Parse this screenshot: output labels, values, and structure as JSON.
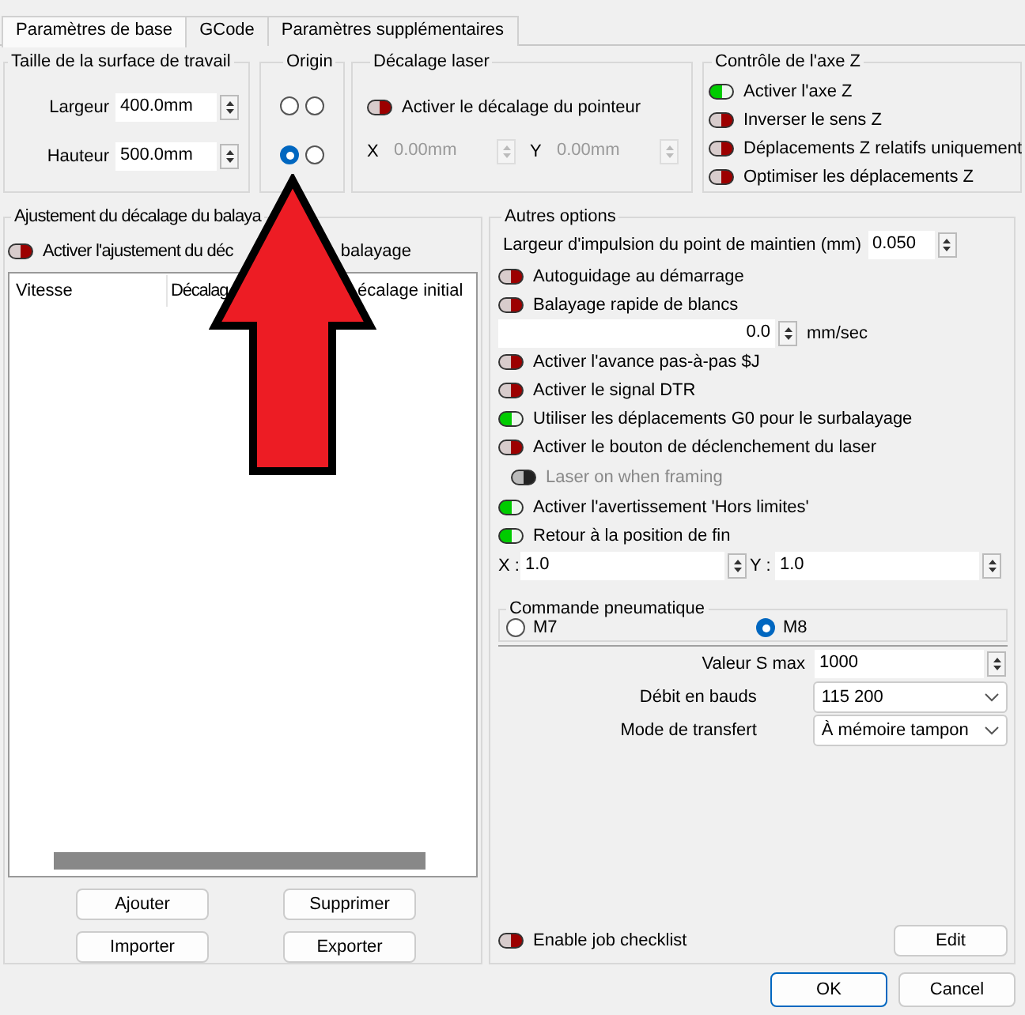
{
  "tabs": [
    {
      "label": "Paramètres de base",
      "selected": true
    },
    {
      "label": "GCode",
      "selected": false
    },
    {
      "label": "Paramètres supplémentaires",
      "selected": false
    }
  ],
  "work_area": {
    "title": "Taille de la surface de travail",
    "fields": [
      {
        "label": "Largeur",
        "value": "400.0mm"
      },
      {
        "label": "Hauteur",
        "value": "500.0mm"
      }
    ]
  },
  "origin": {
    "title": "Origin",
    "options": [
      {
        "selected": false
      },
      {
        "selected": false
      },
      {
        "selected": true
      },
      {
        "selected": false
      }
    ]
  },
  "laser_offset": {
    "title": "Décalage laser",
    "toggle": {
      "label": "Activer le décalage du pointeur",
      "on": false
    },
    "fields": [
      {
        "label": "X",
        "value": "0.00mm",
        "disabled": true
      },
      {
        "label": "Y",
        "value": "0.00mm",
        "disabled": true
      }
    ]
  },
  "z_axis": {
    "title": "Contrôle de l'axe Z",
    "options": [
      {
        "label": "Activer l'axe Z",
        "on": true
      },
      {
        "label": "Inverser le sens Z",
        "on": false
      },
      {
        "label": "Déplacements Z relatifs uniquement",
        "on": false
      },
      {
        "label": "Optimiser les déplacements Z",
        "on": false
      }
    ]
  },
  "scan_offset": {
    "title": "Ajustement du décalage du balaya",
    "toggle": {
      "label": "Activer l'ajustement du déc",
      "label_tail": "balayage",
      "on": false
    },
    "columns": [
      "Vitesse",
      "Décalag",
      "écalage initial"
    ],
    "buttons": [
      "Ajouter",
      "Supprimer",
      "Importer",
      "Exporter"
    ]
  },
  "other_options": {
    "title": "Autres options",
    "items": [
      {
        "kind": "spin",
        "label": "Largeur d'impulsion du point de maintien (mm)",
        "value": "0.050"
      },
      {
        "kind": "toggle",
        "label": "Autoguidage au démarrage",
        "on": false
      },
      {
        "kind": "toggle",
        "label": "Balayage rapide de blancs",
        "on": false
      },
      {
        "kind": "speed",
        "value": "0.0",
        "unit": "mm/sec"
      },
      {
        "kind": "toggle",
        "label": "Activer l'avance pas-à-pas $J",
        "on": false
      },
      {
        "kind": "toggle",
        "label": "Activer le signal DTR",
        "on": false
      },
      {
        "kind": "toggle",
        "label": "Utiliser les déplacements G0 pour le surbalayage",
        "on": true
      },
      {
        "kind": "toggle",
        "label": "Activer le bouton de déclenchement du laser",
        "on": false
      },
      {
        "kind": "toggle",
        "label": "Laser on when framing",
        "on": false,
        "disabled": true,
        "indented": true
      },
      {
        "kind": "toggle",
        "label": "Activer l'avertissement 'Hors limites'",
        "on": true
      },
      {
        "kind": "toggle",
        "label": "Retour à la position de fin",
        "on": true
      },
      {
        "kind": "xy",
        "fields": [
          {
            "label": "X :",
            "value": "1.0"
          },
          {
            "label": "Y :",
            "value": "1.0"
          }
        ]
      }
    ],
    "air_assist": {
      "title": "Commande pneumatique",
      "options": [
        {
          "label": "M7",
          "selected": false
        },
        {
          "label": "M8",
          "selected": true
        }
      ]
    },
    "settings": [
      {
        "kind": "spin",
        "label": "Valeur S max",
        "value": "1000"
      },
      {
        "kind": "select",
        "label": "Débit en bauds",
        "value": "115 200"
      },
      {
        "kind": "select",
        "label": "Mode de transfert",
        "value": "À mémoire tampon"
      }
    ],
    "job_checklist": {
      "label": "Enable job checklist",
      "on": false
    },
    "edit_button": "Edit"
  },
  "dialog_buttons": [
    {
      "label": "OK",
      "default": true
    },
    {
      "label": "Cancel",
      "default": false
    }
  ]
}
